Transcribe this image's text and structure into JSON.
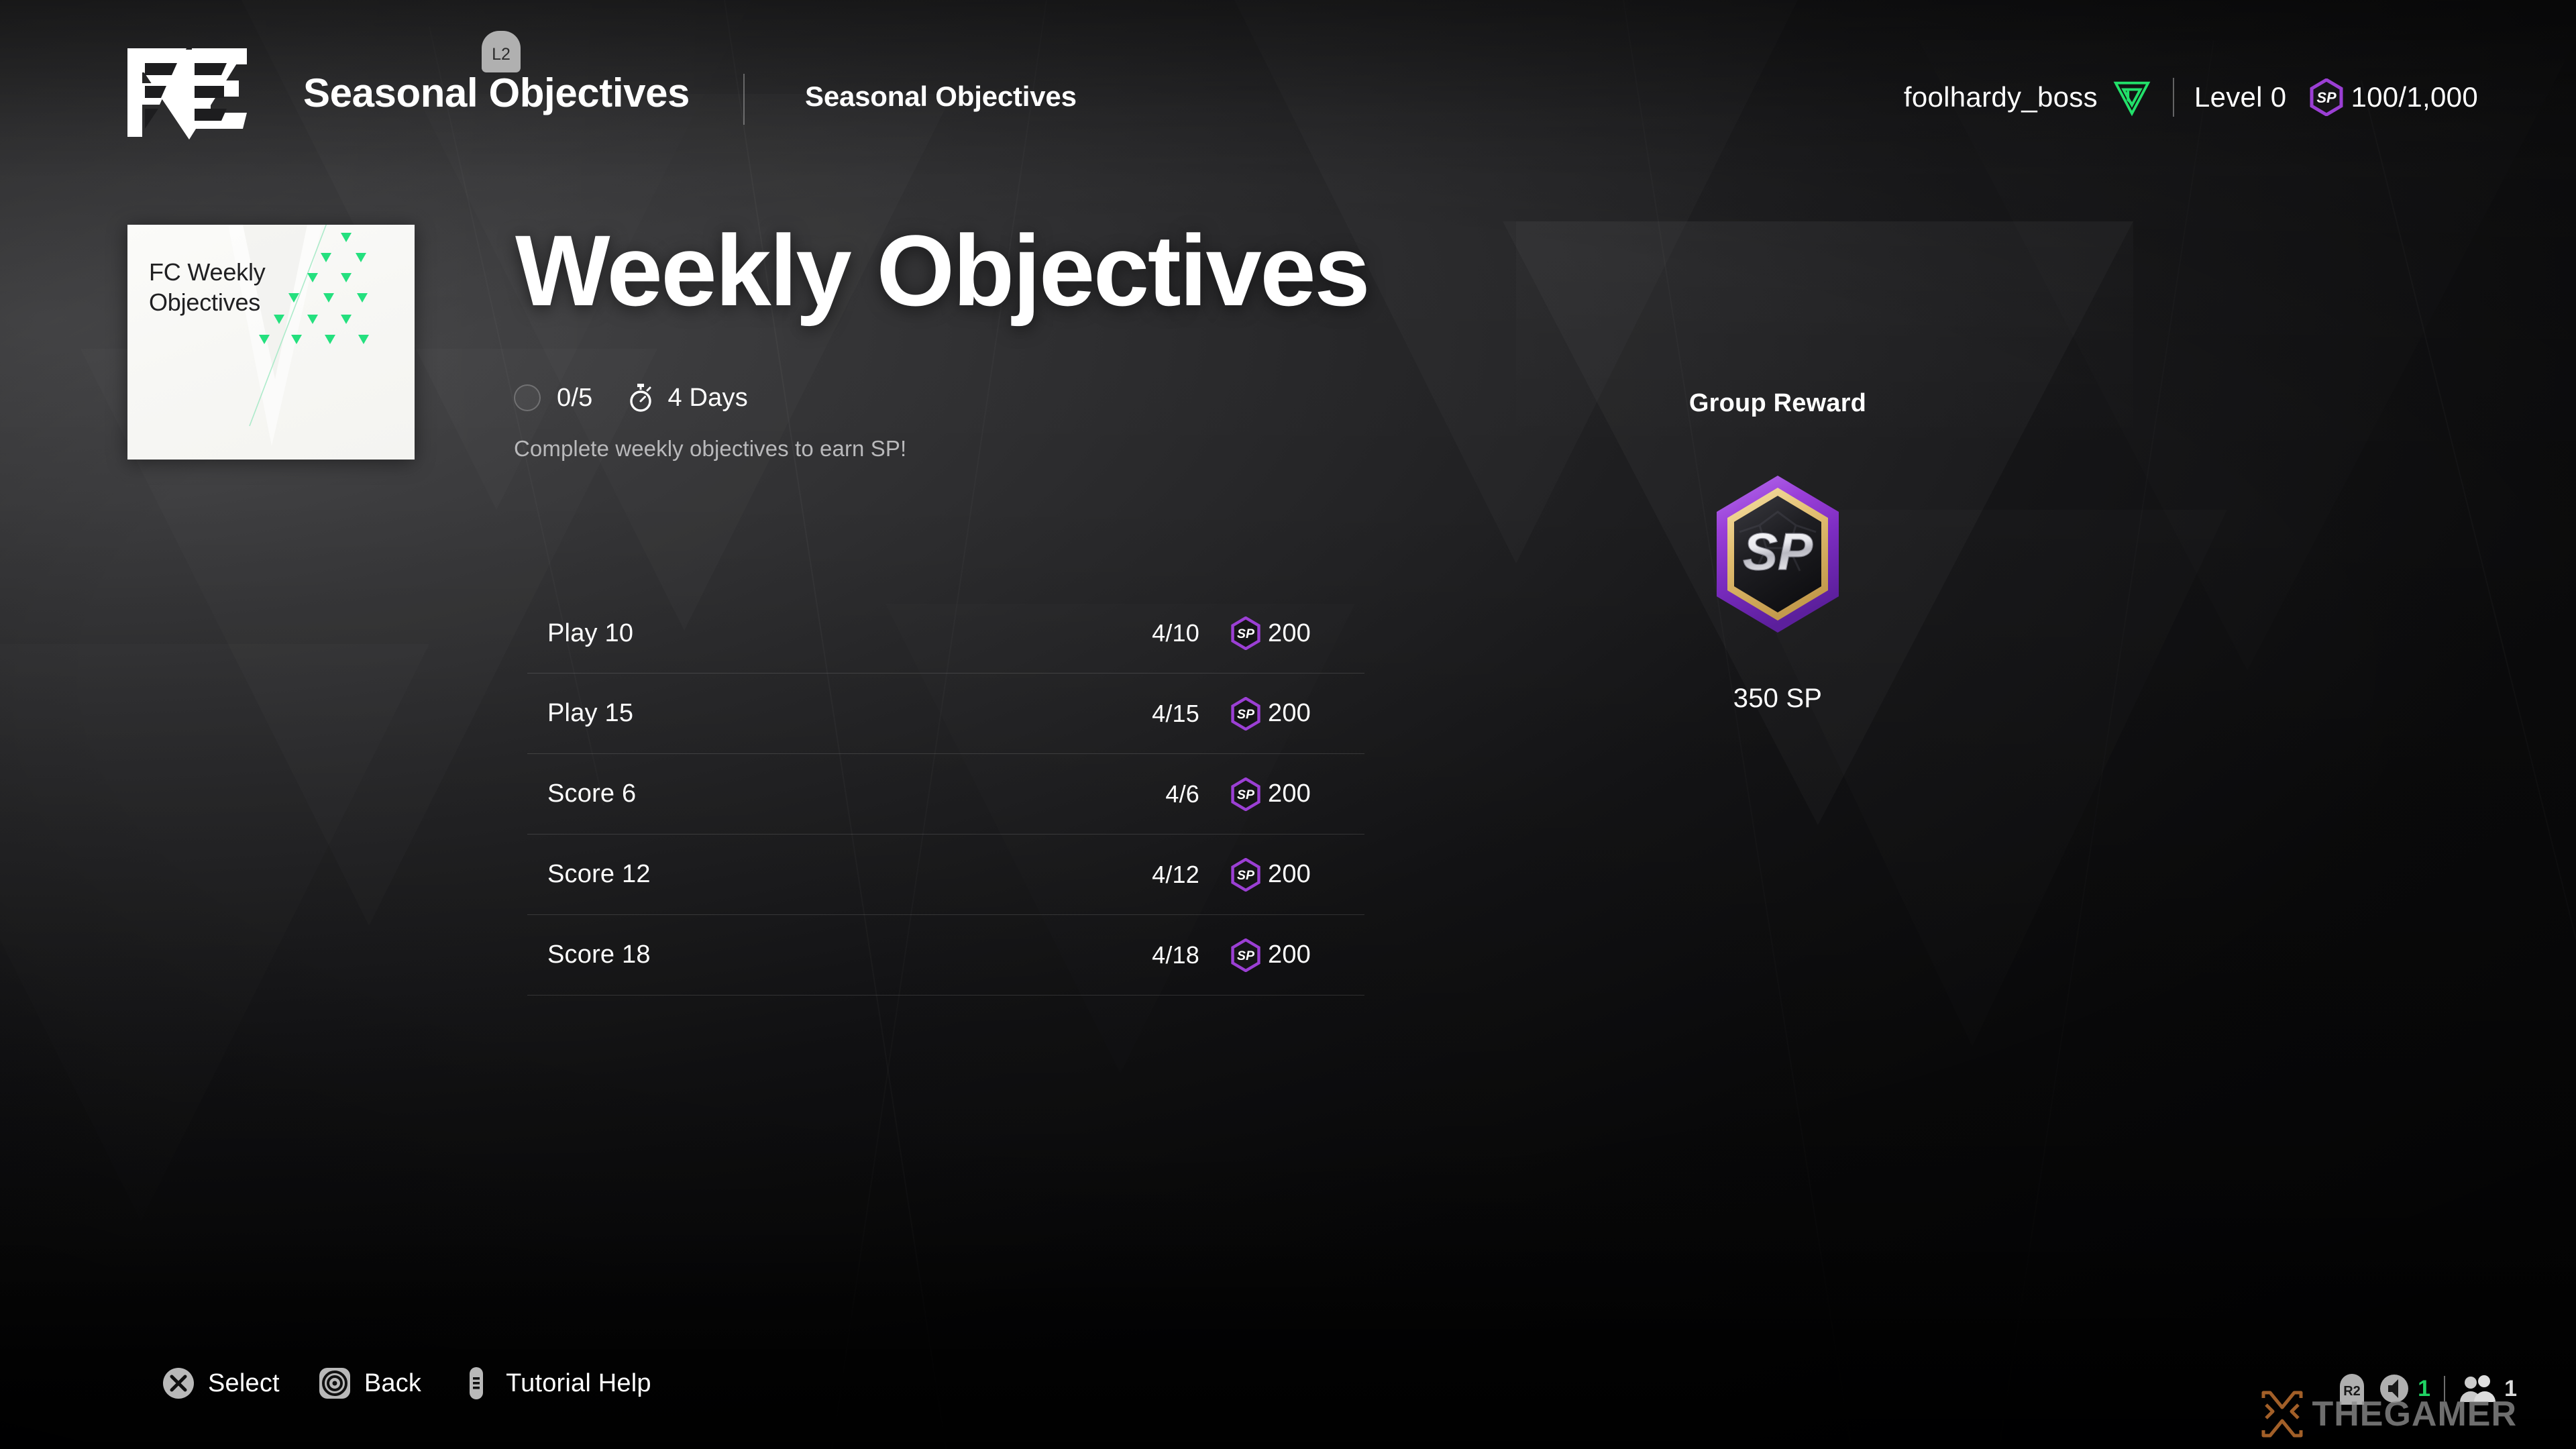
{
  "header": {
    "title": "Seasonal Objectives",
    "subtitle": "Seasonal Objectives",
    "shoulder_hint": "L2",
    "logo_name": "fc-logo"
  },
  "user": {
    "name": "foolhardy_boss",
    "club_icon": "club-crest-icon",
    "level": "Level 0",
    "sp_icon": "sp-hexagon-icon",
    "sp_value": "100/1,000"
  },
  "card": {
    "title": "FC Weekly Objectives"
  },
  "main": {
    "title": "Weekly Objectives",
    "progress_count": "0/5",
    "timer_icon": "stopwatch-icon",
    "time_remaining": "4 Days",
    "description": "Complete weekly objectives to earn SP!"
  },
  "objectives": [
    {
      "label": "Play 10",
      "progress": "4/10",
      "reward_icon": "sp-hexagon-icon",
      "reward": "200"
    },
    {
      "label": "Play 15",
      "progress": "4/15",
      "reward_icon": "sp-hexagon-icon",
      "reward": "200"
    },
    {
      "label": "Score 6",
      "progress": "4/6",
      "reward_icon": "sp-hexagon-icon",
      "reward": "200"
    },
    {
      "label": "Score 12",
      "progress": "4/12",
      "reward_icon": "sp-hexagon-icon",
      "reward": "200"
    },
    {
      "label": "Score 18",
      "progress": "4/18",
      "reward_icon": "sp-hexagon-icon",
      "reward": "200"
    }
  ],
  "group_reward": {
    "title": "Group Reward",
    "badge_icon": "sp-reward-badge",
    "amount": "350 SP"
  },
  "footer": {
    "prompts": [
      {
        "glyph": "cross-button-icon",
        "label": "Select"
      },
      {
        "glyph": "circle-button-icon",
        "label": "Back"
      },
      {
        "glyph": "options-button-icon",
        "label": "Tutorial Help"
      }
    ],
    "status": {
      "trigger": "R2",
      "volume_icon": "speaker-icon",
      "volume_value": "1",
      "party_icon": "people-icon",
      "party_value": "1"
    },
    "watermark": {
      "text": "THEGAMER",
      "mark": "thegamer-x-icon"
    }
  },
  "colors": {
    "accent_green": "#22e06a",
    "sp_purple": "#9b3fd4",
    "sp_gold": "#e8c77a",
    "card_bg": "#f8f8f5",
    "text_primary": "#ffffff",
    "text_muted": "#b9b9bb"
  }
}
